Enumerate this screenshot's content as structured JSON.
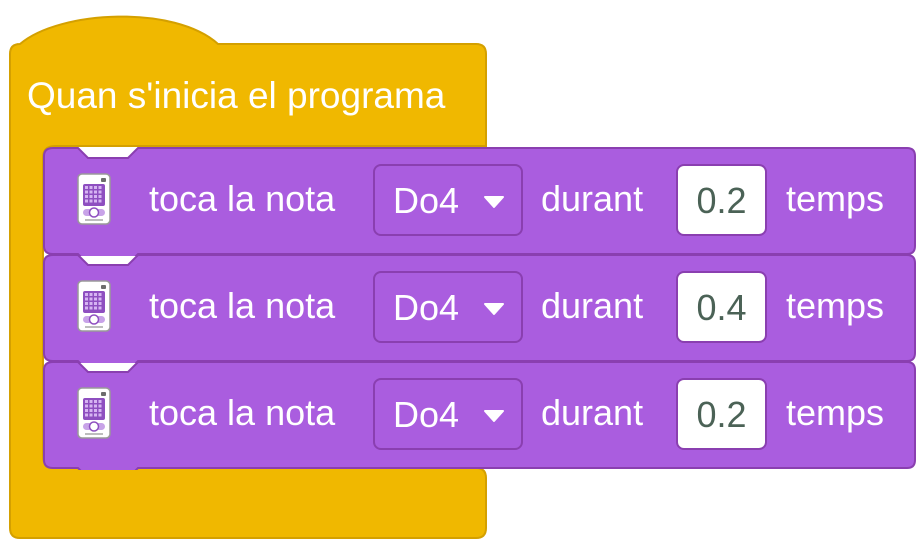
{
  "hat": {
    "title": "Quan s'inicia el programa",
    "color": "#f0b800",
    "border": "#d4a000"
  },
  "block_style": {
    "color": "#aa5ddf",
    "border": "#8a3fb0"
  },
  "blocks": [
    {
      "icon": "hub-icon",
      "label": "toca la nota",
      "note": "Do4",
      "connector": "durant",
      "duration": "0.2",
      "unit": "temps"
    },
    {
      "icon": "hub-icon",
      "label": "toca la nota",
      "note": "Do4",
      "connector": "durant",
      "duration": "0.4",
      "unit": "temps"
    },
    {
      "icon": "hub-icon",
      "label": "toca la nota",
      "note": "Do4",
      "connector": "durant",
      "duration": "0.2",
      "unit": "temps"
    }
  ]
}
